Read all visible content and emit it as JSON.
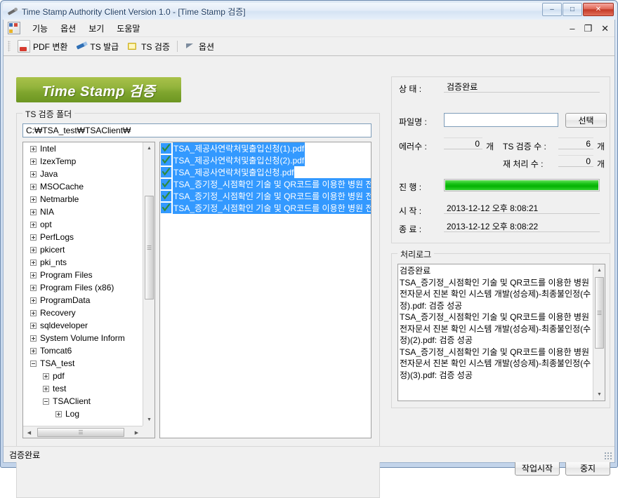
{
  "window": {
    "title": "Time Stamp Authority Client Version 1.0 - [Time Stamp 검증]",
    "app_icon": "stamp-icon",
    "controls": {
      "minimize": "–",
      "maximize": "□",
      "close": "✕"
    }
  },
  "mdi_controls": {
    "minimize": "–",
    "restore": "❐",
    "close": "✕"
  },
  "menu": {
    "icon": "mdi-app-icon",
    "items": [
      {
        "label": "기능"
      },
      {
        "label": "옵션"
      },
      {
        "label": "보기"
      },
      {
        "label": "도움말"
      }
    ]
  },
  "toolbar": {
    "items": [
      {
        "label": "PDF 변환",
        "icon": "pdf-convert-icon"
      },
      {
        "label": "TS 발급",
        "icon": "ts-issue-icon"
      },
      {
        "label": "TS 검증",
        "icon": "ts-verify-icon"
      },
      {
        "label": "옵션",
        "icon": "options-icon"
      }
    ]
  },
  "banner": {
    "title": "Time Stamp 검증",
    "color": "#7fa52e"
  },
  "folder_group": {
    "title": "TS 검증 폴더",
    "path": "C:₩TSA_test₩TSAClient₩",
    "tree": [
      {
        "label": "Intel",
        "level": 1,
        "expander": "plus"
      },
      {
        "label": "IzexTemp",
        "level": 1,
        "expander": "plus"
      },
      {
        "label": "Java",
        "level": 1,
        "expander": "plus"
      },
      {
        "label": "MSOCache",
        "level": 1,
        "expander": "plus"
      },
      {
        "label": "Netmarble",
        "level": 1,
        "expander": "plus"
      },
      {
        "label": "NIA",
        "level": 1,
        "expander": "plus"
      },
      {
        "label": "opt",
        "level": 1,
        "expander": "plus"
      },
      {
        "label": "PerfLogs",
        "level": 1,
        "expander": "plus"
      },
      {
        "label": "pkicert",
        "level": 1,
        "expander": "plus"
      },
      {
        "label": "pki_nts",
        "level": 1,
        "expander": "plus"
      },
      {
        "label": "Program Files",
        "level": 1,
        "expander": "plus"
      },
      {
        "label": "Program Files (x86)",
        "level": 1,
        "expander": "plus"
      },
      {
        "label": "ProgramData",
        "level": 1,
        "expander": "plus"
      },
      {
        "label": "Recovery",
        "level": 1,
        "expander": "plus"
      },
      {
        "label": "sqldeveloper",
        "level": 1,
        "expander": "plus"
      },
      {
        "label": "System Volume Inform",
        "level": 1,
        "expander": "plus"
      },
      {
        "label": "Tomcat6",
        "level": 1,
        "expander": "plus"
      },
      {
        "label": "TSA_test",
        "level": 1,
        "expander": "minus"
      },
      {
        "label": "pdf",
        "level": 2,
        "expander": "plus"
      },
      {
        "label": "test",
        "level": 2,
        "expander": "plus"
      },
      {
        "label": "TSAClient",
        "level": 2,
        "expander": "minus"
      },
      {
        "label": "Log",
        "level": 3,
        "expander": "plus"
      }
    ],
    "files": [
      {
        "label": "TSA_제공사연락처및출입신청(1).pdf",
        "checked": true,
        "selected": true
      },
      {
        "label": "TSA_제공사연락처및출입신청(2).pdf",
        "checked": true,
        "selected": true
      },
      {
        "label": "TSA_제공사연락처및출입신청.pdf",
        "checked": true,
        "selected": true
      },
      {
        "label": "TSA_증기정_시점확인 기술 및 QR코드를 이용한 병원 전",
        "checked": true,
        "selected": true
      },
      {
        "label": "TSA_증기정_시점확인 기술 및 QR코드를 이용한 병원 전",
        "checked": true,
        "selected": true
      },
      {
        "label": "TSA_증기정_시점확인 기술 및 QR코드를 이용한 병원 전",
        "checked": true,
        "selected": true
      }
    ]
  },
  "info": {
    "status_label": "상 태 :",
    "status_value": "검증완료",
    "filename_label": "파일명 :",
    "filename_value": "",
    "select_button": "선택",
    "error_label": "에러수 :",
    "error_value": "0",
    "error_unit": "개",
    "ts_count_label": "TS 검증 수 :",
    "ts_count_value": "6",
    "ts_count_unit": "개",
    "retry_label": "재 처리 수 :",
    "retry_value": "0",
    "retry_unit": "개",
    "progress_label": "진 행 :",
    "progress_percent": 100,
    "progress_color": "#04b204",
    "start_label": "시 작 :",
    "start_value": "2013-12-12 오후 8:08:21",
    "end_label": "종 료 :",
    "end_value": "2013-12-12 오후 8:08:22"
  },
  "log": {
    "title": "처리로그",
    "text": "검증완료\nTSA_증기정_시점확인 기술 및 QR코드를 이용한 병원 전자문서 진본 확인 시스템 개발(성승제)-최종불인정(수정).pdf: 검증 성공\nTSA_증기정_시점확인 기술 및 QR코드를 이용한 병원 전자문서 진본 확인 시스템 개발(성승제)-최종불인정(수정)(2).pdf: 검증 성공\nTSA_증기정_시점확인 기술 및 QR코드를 이용한 병원 전자문서 진본 확인 시스템 개발(성승제)-최종불인정(수정)(3).pdf: 검증 성공"
  },
  "actions": {
    "start": "작업시작",
    "stop": "중지"
  },
  "statusbar": {
    "text": "검증완료"
  }
}
